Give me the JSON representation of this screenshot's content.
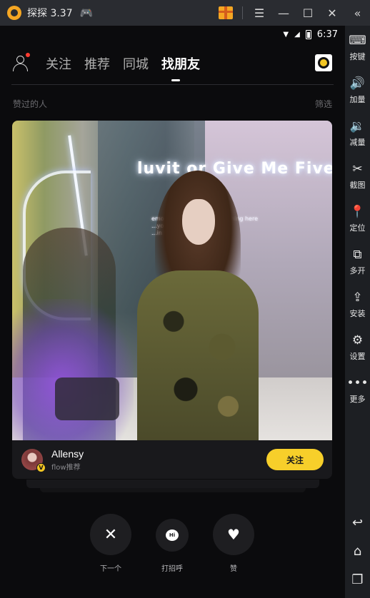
{
  "emulator": {
    "title": "探探 3.37",
    "icons": {
      "logo": "app-logo-icon",
      "gamepad": "gamepad-icon",
      "gift": "gift-icon",
      "menu": "menu-icon",
      "minimize": "minimize-icon",
      "maximize": "maximize-icon",
      "close": "close-icon",
      "collapse": "double-chevron-left-icon"
    },
    "sidebar": [
      {
        "label": "按键",
        "icon": "keyboard-icon"
      },
      {
        "label": "加量",
        "icon": "volume-up-icon"
      },
      {
        "label": "减量",
        "icon": "volume-down-icon"
      },
      {
        "label": "截图",
        "icon": "scissors-icon"
      },
      {
        "label": "定位",
        "icon": "location-pin-icon"
      },
      {
        "label": "多开",
        "icon": "multi-instance-icon"
      },
      {
        "label": "安装",
        "icon": "apk-install-icon"
      },
      {
        "label": "设置",
        "icon": "gear-icon"
      },
      {
        "label": "更多",
        "icon": "more-dots-icon"
      }
    ],
    "nav": [
      "back-icon",
      "home-icon",
      "recents-icon"
    ]
  },
  "statusbar": {
    "time": "6:37"
  },
  "nav": {
    "tabs": [
      {
        "label": "关注"
      },
      {
        "label": "推荐"
      },
      {
        "label": "同城"
      },
      {
        "label": "找朋友"
      }
    ],
    "active_tab": "找朋友"
  },
  "section": {
    "title": "赞过的人",
    "filter": "筛选"
  },
  "card": {
    "photo_text": "luvit or Give Me Five",
    "photo_small_text": [
      "emo... Hope you find something here",
      "...you again",
      "...in there think?"
    ],
    "user": {
      "name": "Allensy",
      "subtitle": "flow推荐",
      "badge": "V"
    },
    "follow_label": "关注"
  },
  "actions": [
    {
      "label": "下一个",
      "icon": "close-x-icon"
    },
    {
      "label": "打招呼",
      "icon": "hi-bubble-icon",
      "icon_text": "Hi"
    },
    {
      "label": "赞",
      "icon": "heart-icon"
    }
  ],
  "colors": {
    "accent": "#f7cf2a",
    "background": "#0b0b0d",
    "card": "#19191c",
    "notification_dot": "#ff3b30"
  }
}
